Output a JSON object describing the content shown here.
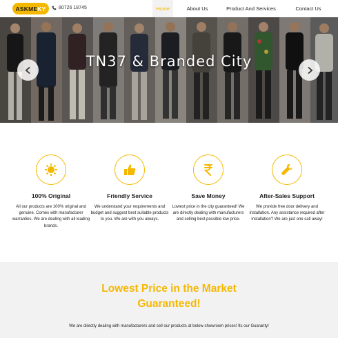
{
  "brand": {
    "logo_text": "ASKMEKY",
    "logo_main": "ASKME",
    "logo_accent": "KY",
    "accent_color": "#f5b800"
  },
  "header": {
    "phone": "80726 18745",
    "nav": [
      {
        "label": "Home",
        "active": true
      },
      {
        "label": "About Us",
        "active": false
      },
      {
        "label": "Product And Services",
        "active": false
      },
      {
        "label": "Contact Us",
        "active": false
      }
    ]
  },
  "hero": {
    "title": "TN37 & Branded City"
  },
  "features": [
    {
      "icon": "sun-icon",
      "title": "100% Original",
      "description": "All our products are 100% original and genuine. Comes with manufacturer warranties. We are dealing with all leading brands."
    },
    {
      "icon": "thumbs-up-icon",
      "title": "Friendly Service",
      "description": "We understand your requirements and budget and suggest best suitable products to you. We are with you always."
    },
    {
      "icon": "rupee-icon",
      "title": "Save Money",
      "description": "Lowest price in the city guaranteed! We are directly dealing with manufacturers and selling best possible low price."
    },
    {
      "icon": "wrench-icon",
      "title": "After-Sales Support",
      "description": "We provide free door delivery and installation. Any assistance required after installation? We are just one call away!"
    }
  ],
  "lowest": {
    "title_line1": "Lowest Price in the Market",
    "title_line2": "Guaranteed!",
    "text": "We are directly dealing with manufacturers and sell our products at below showroom prices! Its our Guaranty!"
  }
}
